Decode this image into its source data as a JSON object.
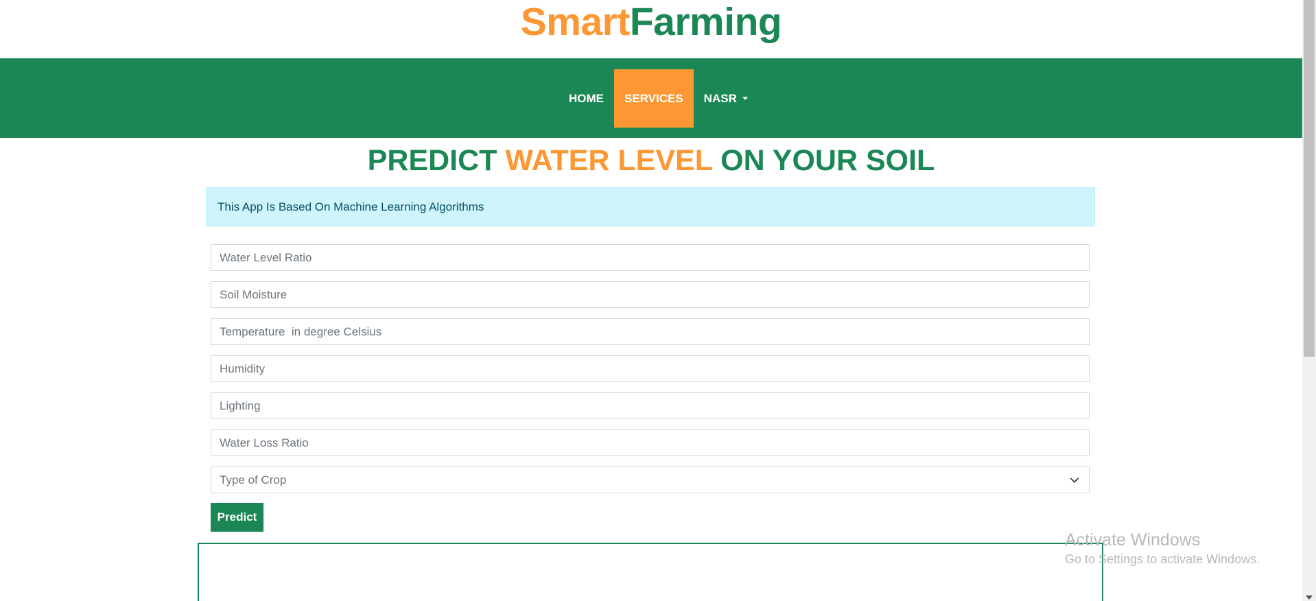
{
  "brand": {
    "part1": "Smart",
    "part2": "Farming"
  },
  "nav": {
    "items": [
      {
        "label": "HOME"
      },
      {
        "label": "SERVICES"
      },
      {
        "label": "NASR"
      }
    ]
  },
  "heading": {
    "part1": "PREDICT ",
    "part2": "WATER LEVEL",
    "part3": " ON YOUR SOIL"
  },
  "alert": {
    "text": "This App Is Based On Machine Learning Algorithms"
  },
  "form": {
    "water_level_ratio": {
      "placeholder": "Water Level Ratio"
    },
    "soil_moisture": {
      "placeholder": "Soil Moisture"
    },
    "temperature": {
      "placeholder": "Temperature  in degree Celsius"
    },
    "humidity": {
      "placeholder": "Humidity"
    },
    "lighting": {
      "placeholder": "Lighting"
    },
    "water_loss_ratio": {
      "placeholder": "Water Loss Ratio"
    },
    "crop_type": {
      "selected": "Type of Crop"
    },
    "predict_label": "Predict"
  },
  "watermark": {
    "line1": "Activate Windows",
    "line2": "Go to Settings to activate Windows."
  },
  "colors": {
    "primary_green": "#1a8754",
    "accent_orange": "#fd9734",
    "alert_bg": "#cff4fc"
  }
}
